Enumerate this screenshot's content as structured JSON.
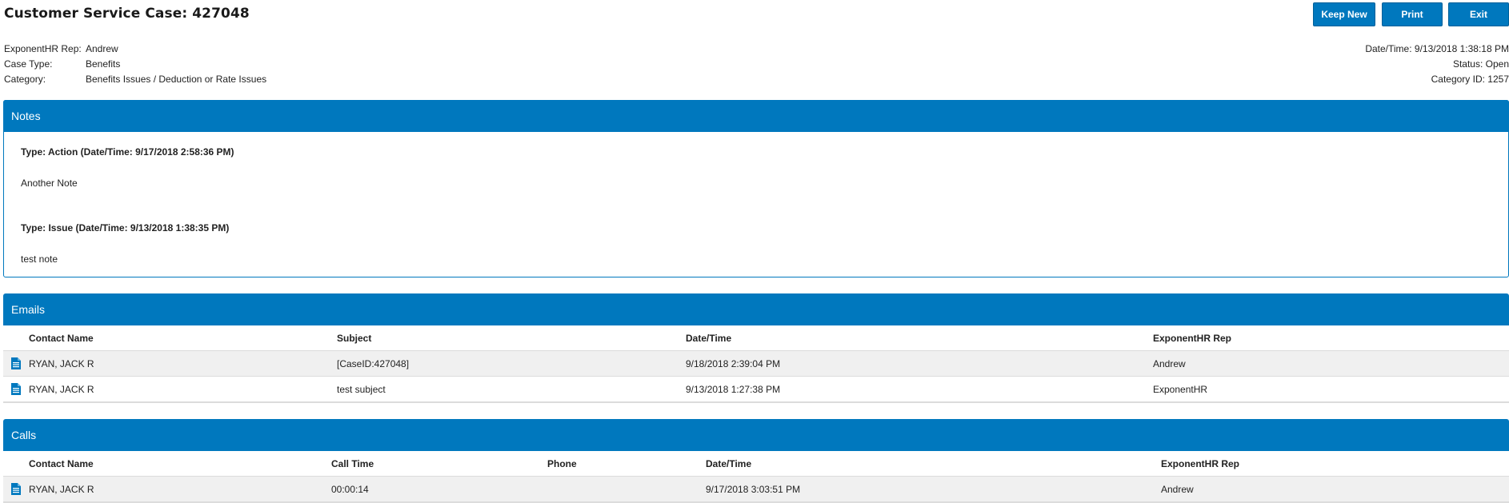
{
  "page": {
    "title": "Customer Service Case: 427048"
  },
  "toolbar": {
    "keep_new_label": "Keep New",
    "print_label": "Print",
    "exit_label": "Exit"
  },
  "case_info": {
    "rep_label": "ExponentHR Rep:",
    "rep_value": "Andrew",
    "type_label": "Case Type:",
    "type_value": "Benefits",
    "category_label": "Category:",
    "category_value": "Benefits Issues / Deduction or Rate Issues",
    "datetime": "Date/Time: 9/13/2018 1:38:18 PM",
    "status": "Status: Open",
    "category_id": "Category ID: 1257"
  },
  "notes": {
    "header": "Notes",
    "items": [
      {
        "type": "Type: Action (Date/Time: 9/17/2018 2:58:36 PM)",
        "text": "Another Note"
      },
      {
        "type": "Type: Issue (Date/Time: 9/13/2018 1:38:35 PM)",
        "text": "test note"
      }
    ]
  },
  "emails": {
    "header": "Emails",
    "columns": [
      "Contact Name",
      "Subject",
      "Date/Time",
      "ExponentHR Rep"
    ],
    "rows": [
      {
        "icon": "document-icon",
        "contact": "RYAN, JACK R",
        "subject": "[CaseID:427048]",
        "datetime": "9/18/2018 2:39:04 PM",
        "rep": "Andrew"
      },
      {
        "icon": "document-icon",
        "contact": "RYAN, JACK R",
        "subject": "test subject",
        "datetime": "9/13/2018 1:27:38 PM",
        "rep": "ExponentHR"
      }
    ]
  },
  "calls": {
    "header": "Calls",
    "columns": [
      "Contact Name",
      "Call Time",
      "Phone",
      "Date/Time",
      "ExponentHR Rep"
    ],
    "rows": [
      {
        "icon": "document-icon",
        "contact": "RYAN, JACK R",
        "call_time": "00:00:14",
        "phone": "",
        "datetime": "9/17/2018 3:03:51 PM",
        "rep": "Andrew"
      }
    ]
  },
  "colors": {
    "accent": "#0078be",
    "row_alt": "#f0f0f0"
  }
}
